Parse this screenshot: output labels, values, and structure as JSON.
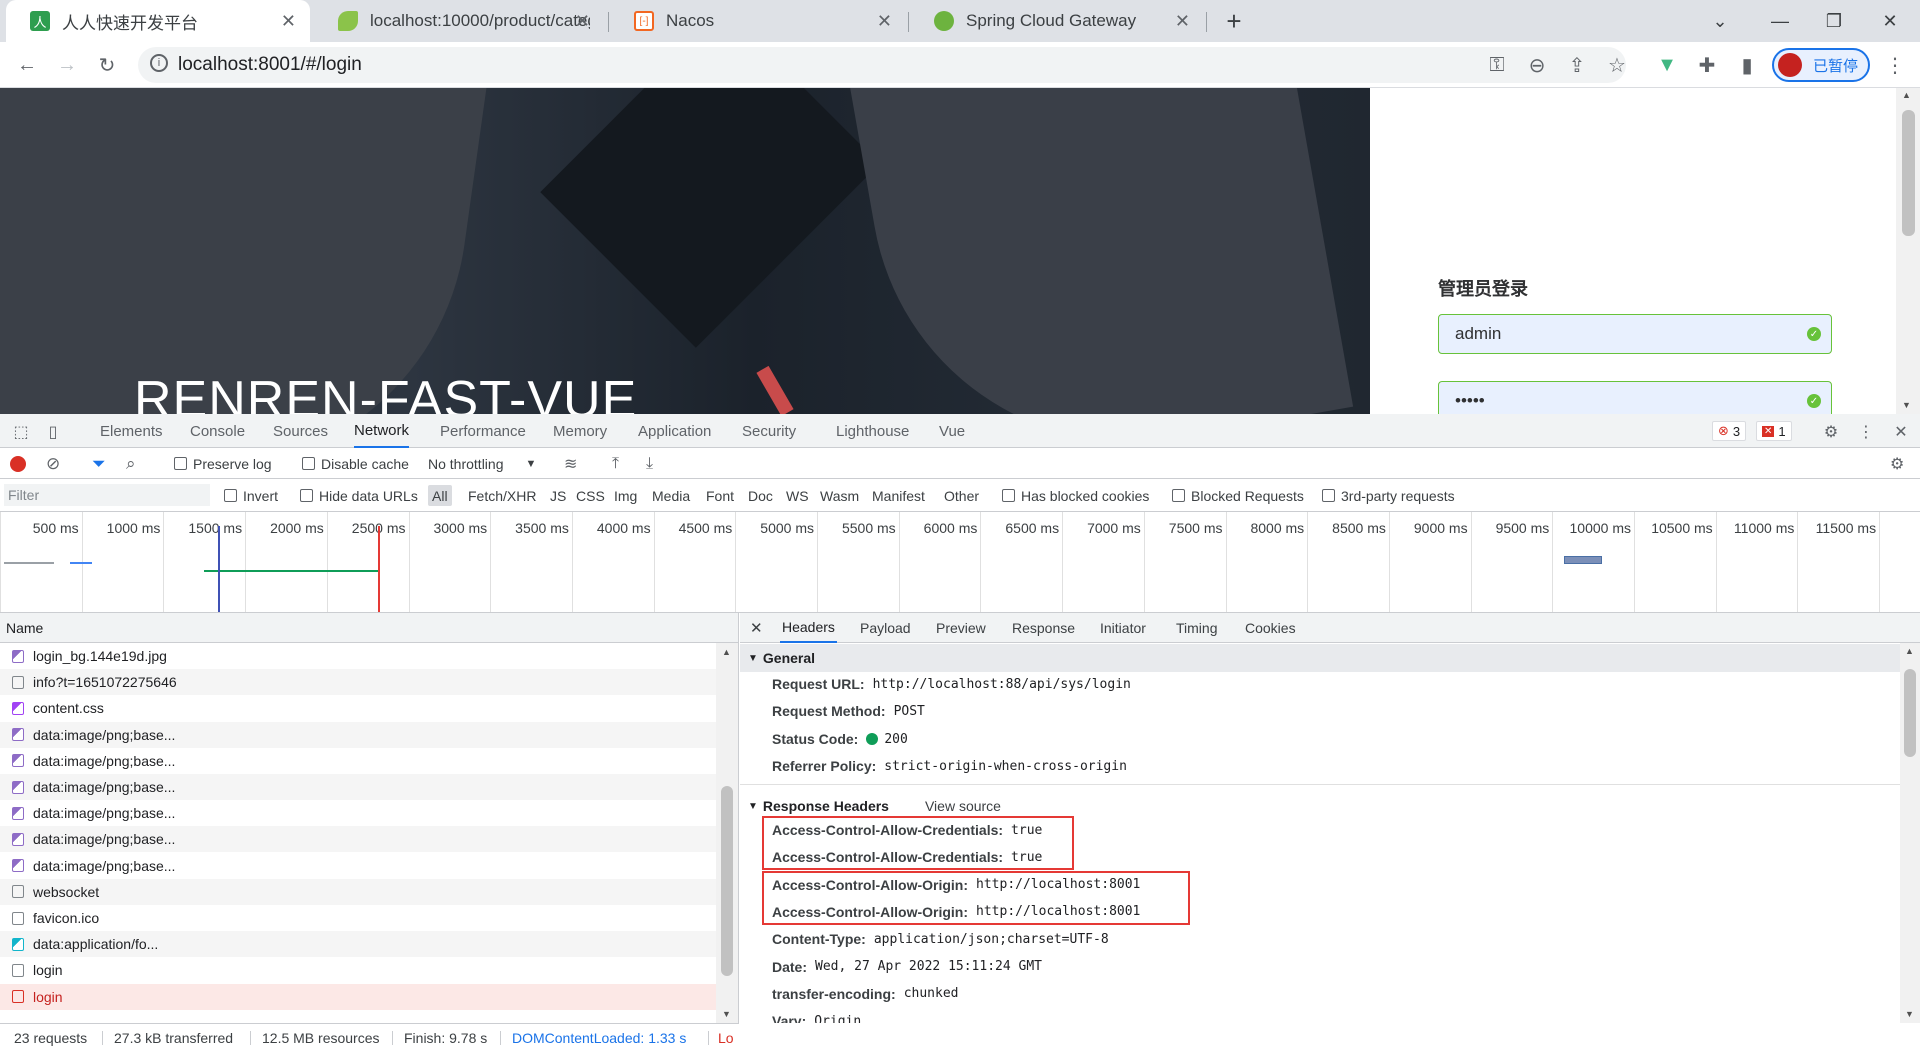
{
  "browser": {
    "tabs": [
      {
        "title": "人人快速开发平台",
        "icon": "renren-icon",
        "active": true
      },
      {
        "title": "localhost:10000/product/categ",
        "icon": "spring-leaf-icon",
        "active": false
      },
      {
        "title": "Nacos",
        "icon": "nacos-icon",
        "active": false
      },
      {
        "title": "Spring Cloud Gateway",
        "icon": "spring-icon",
        "active": false
      }
    ],
    "new_tab": "+",
    "url": "localhost:8001/#/login",
    "profile_label": "已暂停"
  },
  "page": {
    "brand": "RENREN-FAST-VUE",
    "login_title": "管理员登录",
    "username_value": "admin",
    "password_value": "•••••"
  },
  "devtools": {
    "tabs": [
      "Elements",
      "Console",
      "Sources",
      "Network",
      "Performance",
      "Memory",
      "Application",
      "Security",
      "Lighthouse",
      "Vue"
    ],
    "selected_tab": "Network",
    "errors_count": "3",
    "issues_count": "1",
    "network_bar": {
      "preserve_log": "Preserve log",
      "disable_cache": "Disable cache",
      "throttling": "No throttling"
    },
    "filter": {
      "placeholder": "Filter",
      "invert": "Invert",
      "hide_data_urls": "Hide data URLs",
      "types": [
        "All",
        "Fetch/XHR",
        "JS",
        "CSS",
        "Img",
        "Media",
        "Font",
        "Doc",
        "WS",
        "Wasm",
        "Manifest",
        "Other"
      ],
      "has_blocked_cookies": "Has blocked cookies",
      "blocked_requests": "Blocked Requests",
      "third_party": "3rd-party requests"
    },
    "timeline_ticks": [
      "500 ms",
      "1000 ms",
      "1500 ms",
      "2000 ms",
      "2500 ms",
      "3000 ms",
      "3500 ms",
      "4000 ms",
      "4500 ms",
      "5000 ms",
      "5500 ms",
      "6000 ms",
      "6500 ms",
      "7000 ms",
      "7500 ms",
      "8000 ms",
      "8500 ms",
      "9000 ms",
      "9500 ms",
      "10000 ms",
      "10500 ms",
      "11000 ms",
      "11500 ms",
      "120"
    ],
    "request_list": {
      "header": "Name",
      "rows": [
        {
          "name": "login_bg.144e19d.jpg",
          "icon": "image-icon"
        },
        {
          "name": "info?t=1651072275646",
          "icon": "xhr-icon"
        },
        {
          "name": "content.css",
          "icon": "css-icon"
        },
        {
          "name": "data:image/png;base...",
          "icon": "image-icon"
        },
        {
          "name": "data:image/png;base...",
          "icon": "image-icon"
        },
        {
          "name": "data:image/png;base...",
          "icon": "image-icon"
        },
        {
          "name": "data:image/png;base...",
          "icon": "image-icon"
        },
        {
          "name": "data:image/png;base...",
          "icon": "image-icon"
        },
        {
          "name": "data:image/png;base...",
          "icon": "image-icon"
        },
        {
          "name": "websocket",
          "icon": "document-icon"
        },
        {
          "name": "favicon.ico",
          "icon": "document-icon"
        },
        {
          "name": "data:application/fo...",
          "icon": "font-icon"
        },
        {
          "name": "login",
          "icon": "document-icon"
        },
        {
          "name": "login",
          "icon": "document-icon",
          "error": true
        }
      ]
    },
    "detail_tabs": [
      "Headers",
      "Payload",
      "Preview",
      "Response",
      "Initiator",
      "Timing",
      "Cookies"
    ],
    "general": {
      "title": "General",
      "rows": [
        {
          "key": "Request URL:",
          "value": "http://localhost:88/api/sys/login"
        },
        {
          "key": "Request Method:",
          "value": "POST"
        },
        {
          "key": "Status Code:",
          "value": "200"
        },
        {
          "key": "Referrer Policy:",
          "value": "strict-origin-when-cross-origin"
        }
      ]
    },
    "response_headers": {
      "title": "Response Headers",
      "view_source": "View source",
      "rows": [
        {
          "key": "Access-Control-Allow-Credentials:",
          "value": "true"
        },
        {
          "key": "Access-Control-Allow-Credentials:",
          "value": "true"
        },
        {
          "key": "Access-Control-Allow-Origin:",
          "value": "http://localhost:8001"
        },
        {
          "key": "Access-Control-Allow-Origin:",
          "value": "http://localhost:8001"
        },
        {
          "key": "Content-Type:",
          "value": "application/json;charset=UTF-8"
        },
        {
          "key": "Date:",
          "value": "Wed, 27 Apr 2022 15:11:24 GMT"
        },
        {
          "key": "transfer-encoding:",
          "value": "chunked"
        },
        {
          "key": "Vary:",
          "value": "Origin"
        }
      ]
    },
    "status_bar": {
      "requests": "23 requests",
      "transferred": "27.3 kB transferred",
      "resources": "12.5 MB resources",
      "finish": "Finish: 9.78 s",
      "dom_content_loaded": "DOMContentLoaded: 1.33 s",
      "load": "Lo"
    }
  }
}
